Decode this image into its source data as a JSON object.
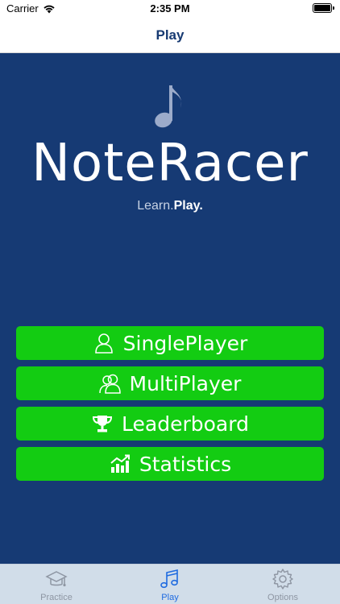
{
  "status_bar": {
    "carrier": "Carrier",
    "time": "2:35 PM"
  },
  "nav": {
    "title": "Play"
  },
  "hero": {
    "app_name": "NoteRacer",
    "tagline_learn": "Learn.",
    "tagline_play": "Play."
  },
  "menu": [
    {
      "label": "SinglePlayer",
      "icon": "person-icon"
    },
    {
      "label": "MultiPlayer",
      "icon": "people-icon"
    },
    {
      "label": "Leaderboard",
      "icon": "trophy-icon"
    },
    {
      "label": "Statistics",
      "icon": "chart-icon"
    }
  ],
  "tabs": [
    {
      "label": "Practice",
      "icon": "graduation-cap-icon",
      "active": false
    },
    {
      "label": "Play",
      "icon": "music-note-icon",
      "active": true
    },
    {
      "label": "Options",
      "icon": "gear-icon",
      "active": false
    }
  ],
  "colors": {
    "background": "#163a74",
    "button": "#13cc12",
    "nav_title": "#173a72",
    "tab_active": "#1f6be0",
    "tab_inactive": "#8e96a3"
  }
}
